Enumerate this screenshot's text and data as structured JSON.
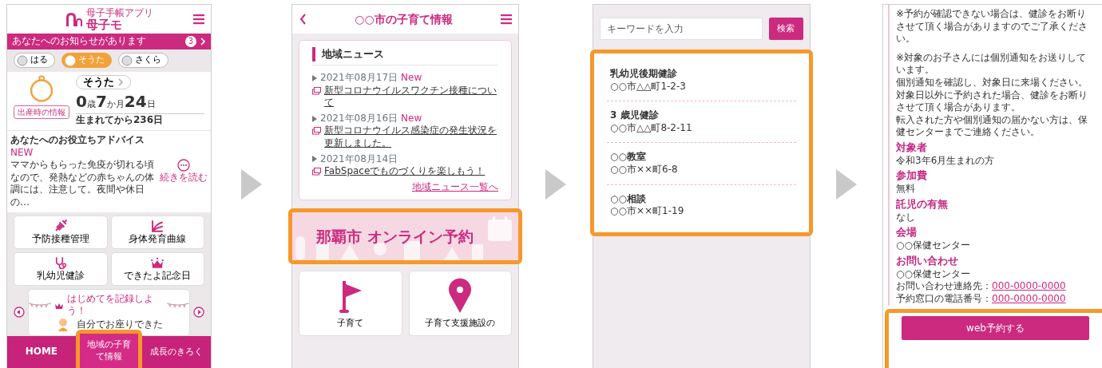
{
  "home": {
    "logo_caption": "母子手帳アプリ",
    "logo_title": "母子モ",
    "notice": {
      "text": "あなたへのお知らせがあります",
      "count": "3"
    },
    "children": [
      {
        "name": "はる",
        "selected": false
      },
      {
        "name": "そうた",
        "selected": true
      },
      {
        "name": "さくら",
        "selected": false
      }
    ],
    "profile": {
      "name": "そうた",
      "age": [
        {
          "value": "0",
          "unit": "歳"
        },
        {
          "value": "7",
          "unit": "か月"
        },
        {
          "value": "24",
          "unit": "日"
        }
      ],
      "since_birth": "生まれてから236日",
      "birth_info": "出産時の情報"
    },
    "advice": {
      "title": "あなたへのお役立ちアドバイス",
      "badge": "NEW",
      "text": "ママからもらった免疫が切れる頃なので、発熱などの赤ちゃんの体調には、注意して。夜間や休日の…",
      "more": "続きを読む"
    },
    "menu": [
      {
        "label": "予防接種管理"
      },
      {
        "label": "身体発育曲線"
      },
      {
        "label": "乳幼児健診"
      },
      {
        "label": "できたよ記念日"
      }
    ],
    "milestone": {
      "title": "はじめてを記録しよう！",
      "text": "自分でお座りできた"
    },
    "bottom_nav": [
      {
        "label": "HOME",
        "highlighted": false
      },
      {
        "label": "地域の子育て情報",
        "highlighted": true
      },
      {
        "label": "成長のきろく",
        "highlighted": false
      }
    ]
  },
  "news": {
    "title": "○○市の子育て情報",
    "section_title": "地域ニュース",
    "items": [
      {
        "date": "2021年08月17日",
        "badge": "New",
        "title": "新型コロナウイルスワクチン接種について"
      },
      {
        "date": "2021年08月16日",
        "badge": "New",
        "title": "新型コロナウイルス感染症の発生状況を更新しました。"
      },
      {
        "date": "2021年08月14日",
        "title": "FabSpaceでものづくりを楽しもう！"
      }
    ],
    "more_link": "地域ニュース一覧へ",
    "banner": {
      "text": "那覇市 オンライン予約",
      "highlighted": true
    },
    "tiles": [
      {
        "label": "子育て"
      },
      {
        "label": "子育て支援施設の"
      }
    ]
  },
  "search": {
    "placeholder": "キーワードを入力",
    "button": "検索",
    "highlighted": true,
    "results": [
      {
        "name": "乳幼児後期健診",
        "address": "○○市△△町1-2-3"
      },
      {
        "name": "3 歳児健診",
        "address": "○○市△△町8-2-11"
      },
      {
        "name": "○○教室",
        "address": "○○市××町6-8"
      },
      {
        "name": "○○相談",
        "address": "○○市××町1-19"
      }
    ]
  },
  "detail": {
    "paragraphs": [
      [
        "※予約が確認できない場合は、健診をお断りさせて頂く場合がありますのでご了承ください。"
      ],
      [
        "※対象のお子さんには個別通知をお送りしています。",
        "個別通知を確認し、対象日に来場ください。",
        "対象日以外に予約された場合、健診をお断りさせて頂く場合があります。",
        "転入された方や個別通知の届かない方は、保健センターまでご連絡ください。"
      ]
    ],
    "sections": [
      {
        "heading": "対象者",
        "value": "令和3年6月生まれの方"
      },
      {
        "heading": "参加費",
        "value": "無料"
      },
      {
        "heading": "託児の有無",
        "value": "なし"
      },
      {
        "heading": "会場",
        "value": "○○保健センター"
      }
    ],
    "contact": {
      "heading": "お問い合わせ",
      "name": "○○保健センター",
      "links": [
        {
          "label": "お問い合わせ連絡先：",
          "number": "000-0000-0000"
        },
        {
          "label": "予約窓口の電話番号：",
          "number": "000-0000-0000"
        }
      ]
    },
    "button": "web予約する",
    "highlighted": true
  }
}
